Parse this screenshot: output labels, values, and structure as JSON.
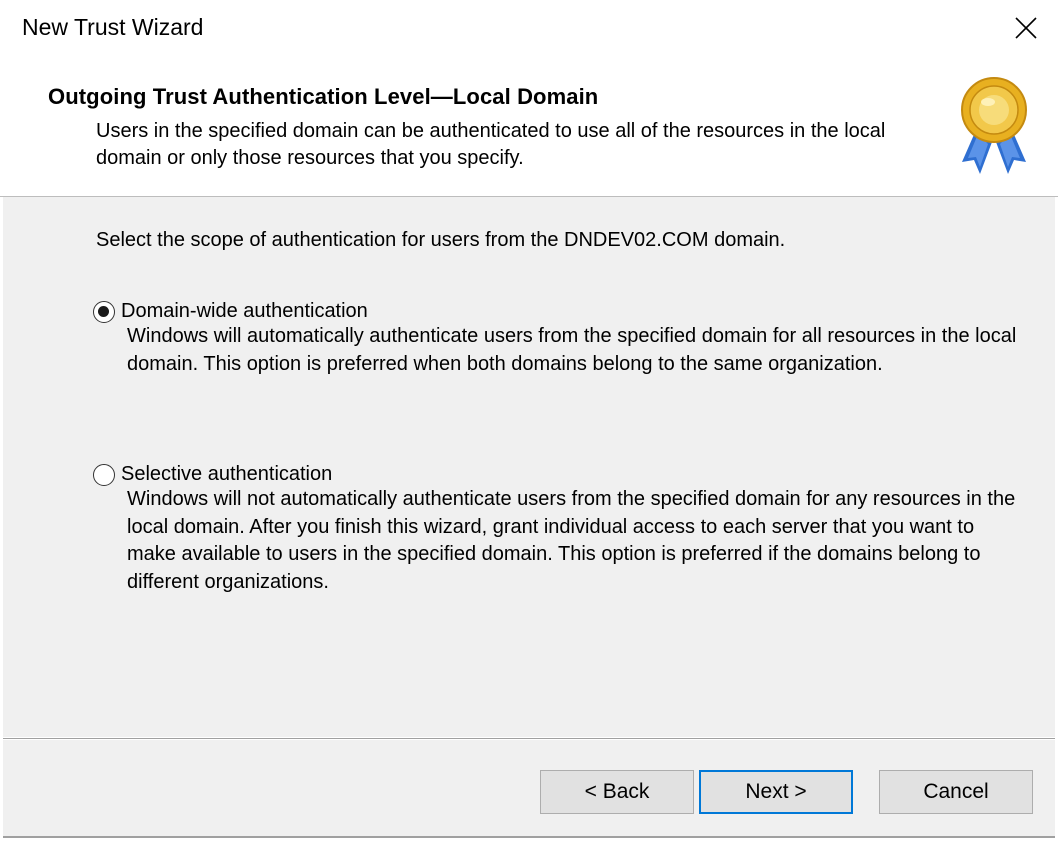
{
  "window": {
    "title": "New Trust Wizard",
    "close_icon": "close-icon"
  },
  "header": {
    "title": "Outgoing Trust Authentication Level—Local Domain",
    "description": "Users in the specified domain can be authenticated to use all of the resources in the local domain or only those resources that you specify.",
    "icon": "award-ribbon-icon"
  },
  "content": {
    "prompt": "Select the scope of authentication for users from the DNDEV02.COM domain.",
    "options": [
      {
        "label": "Domain-wide authentication",
        "description": "Windows will automatically authenticate users from the specified domain for all resources in the local domain. This option is preferred when both domains belong to the same organization.",
        "selected": true
      },
      {
        "label": "Selective authentication",
        "description": "Windows will not automatically authenticate users from the specified domain for any resources in the local domain. After you finish this wizard, grant individual access to each server that you want to make available to users in the specified domain. This option is preferred if the domains belong to different organizations.",
        "selected": false
      }
    ]
  },
  "footer": {
    "back_label": "< Back",
    "next_label": "Next >",
    "cancel_label": "Cancel"
  },
  "colors": {
    "accent": "#0078d7",
    "content_bg": "#f0f0f0",
    "button_bg": "#e1e1e1",
    "medal_gold": "#e8b020",
    "ribbon_blue": "#2f6fd1"
  }
}
